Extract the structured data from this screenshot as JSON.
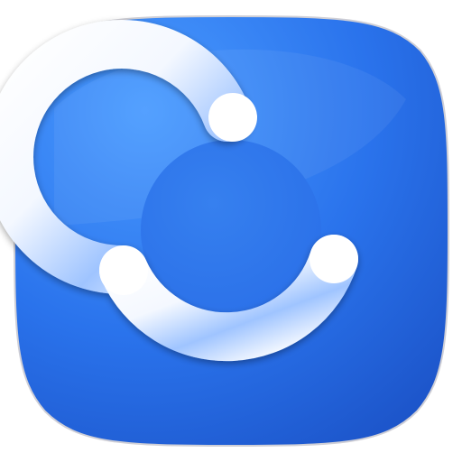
{
  "app_icon": {
    "icon_name": "connected-services-ring-icon",
    "shape": "squircle",
    "colors": {
      "background_light": "#4a9bff",
      "background_mid": "#2a73ec",
      "background_dark": "#1c54c9",
      "ring_white": "#ffffff",
      "ring_blue_shade": "#2f7ae6",
      "inner_disc": "#2a6fe8",
      "outline": "#cfcfd6"
    }
  }
}
